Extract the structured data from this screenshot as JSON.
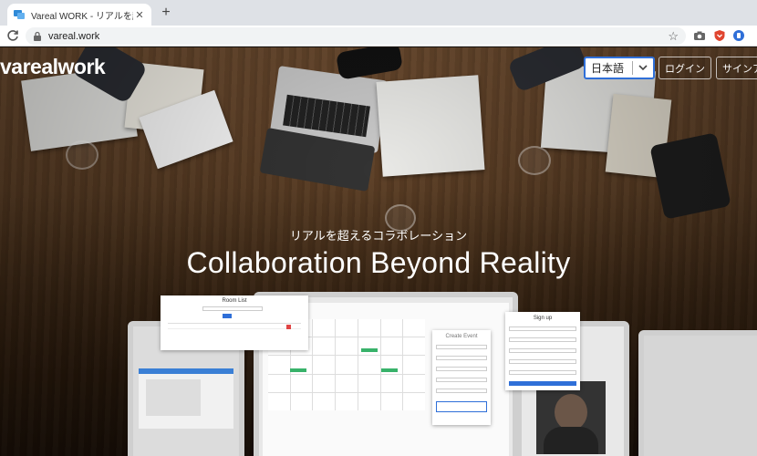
{
  "browser": {
    "tab_title": "Vareal WORK - リアルを超えるコラボレーション",
    "tab_close": "✕",
    "new_tab": "+",
    "url": "vareal.work",
    "star": "☆"
  },
  "site": {
    "logo": "varealwork",
    "language": {
      "selected": "日本語"
    },
    "login_label": "ログイン",
    "signup_label": "サインア"
  },
  "hero": {
    "tagline": "リアルを超えるコラボレーション",
    "headline": "Collaboration Beyond Reality"
  },
  "mockup": {
    "room_list_title": "Room List",
    "create_event_title": "Create Event",
    "sign_up_title": "Sign up"
  },
  "colors": {
    "accent_blue": "#2f6fd8",
    "calendar_tag": "#38b26a"
  }
}
